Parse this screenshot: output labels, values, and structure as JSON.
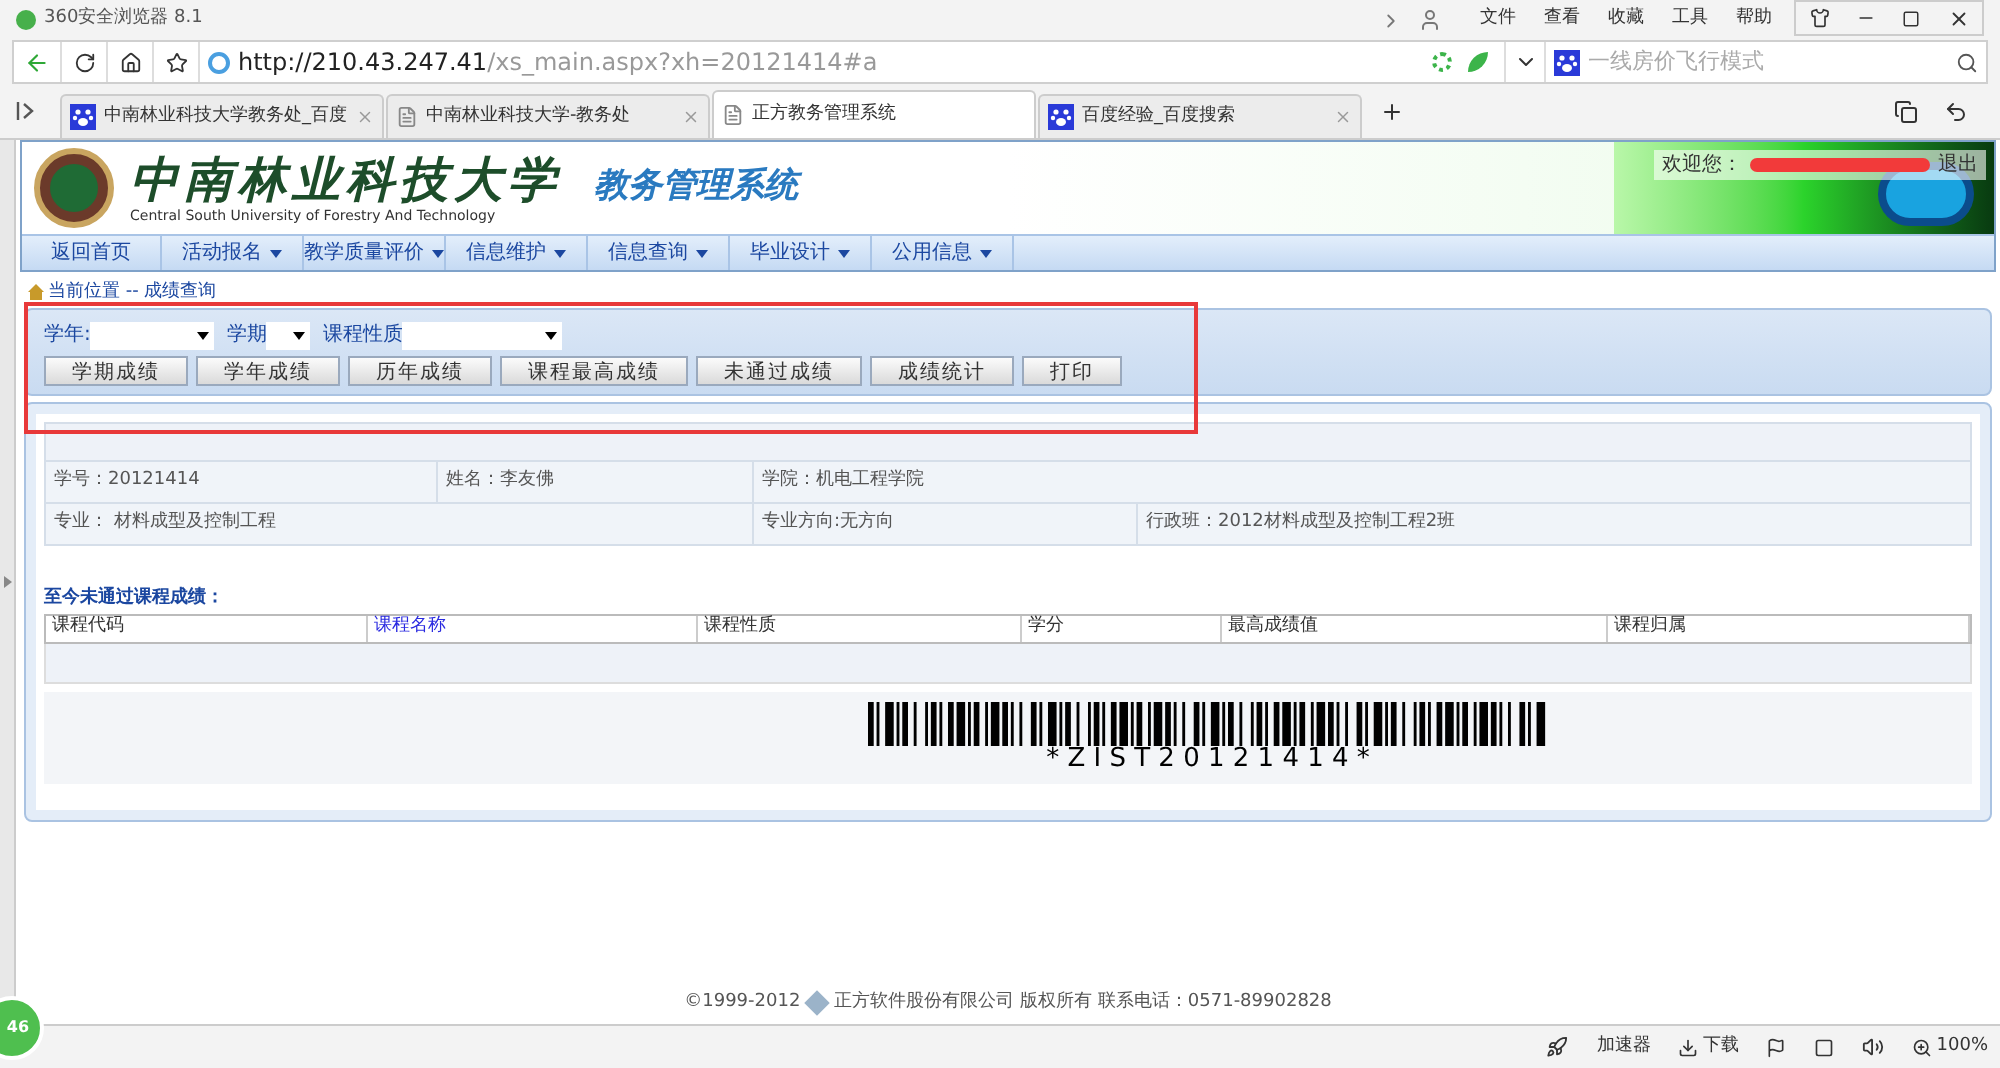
{
  "browser": {
    "title": "360安全浏览器 8.1",
    "menu": [
      "文件",
      "查看",
      "收藏",
      "工具",
      "帮助"
    ],
    "address": {
      "host": "http://210.43.247.41",
      "path": "/xs_main.aspx?xh=20121414#a"
    },
    "search": {
      "placeholder": "一线房价飞行模式"
    },
    "tabs": [
      {
        "label": "中南林业科技大学教务处_百度",
        "kind": "search",
        "selected": false
      },
      {
        "label": "中南林业科技大学-教务处",
        "kind": "page",
        "selected": false
      },
      {
        "label": "正方教务管理系统",
        "kind": "page",
        "selected": true
      },
      {
        "label": "百度经验_百度搜索",
        "kind": "search",
        "selected": false
      }
    ]
  },
  "header": {
    "school_cn": "中南林业科技大学",
    "school_en": "Central South University of Forestry And Technology",
    "system": "教务管理系统",
    "welcome": "欢迎您：",
    "logout": "退出"
  },
  "nav": [
    {
      "label": "返回首页",
      "has_menu": false
    },
    {
      "label": "活动报名",
      "has_menu": true
    },
    {
      "label": "教学质量评价",
      "has_menu": true
    },
    {
      "label": "信息维护",
      "has_menu": true
    },
    {
      "label": "信息查询",
      "has_menu": true
    },
    {
      "label": "毕业设计",
      "has_menu": true
    },
    {
      "label": "公用信息",
      "has_menu": true
    }
  ],
  "breadcrumb": "当前位置 -- 成绩查询",
  "filters": [
    {
      "label": "学年:"
    },
    {
      "label": "学期"
    },
    {
      "label": "课程性质"
    }
  ],
  "buttons": [
    "学期成绩",
    "学年成绩",
    "历年成绩",
    "课程最高成绩",
    "未通过成绩",
    "成绩统计",
    "打印"
  ],
  "student": {
    "fields": [
      "学号：20121414",
      "姓名：李友佛",
      "学院：机电工程学院",
      "专业： 材料成型及控制工程",
      "专业方向:无方向",
      "行政班：2012材料成型及控制工程2班"
    ]
  },
  "failed": {
    "title": "至今未通过课程成绩：",
    "columns": [
      {
        "label": "课程代码",
        "link": false
      },
      {
        "label": "课程名称",
        "link": true
      },
      {
        "label": "课程性质",
        "link": false
      },
      {
        "label": "学分",
        "link": false
      },
      {
        "label": "最高成绩值",
        "link": false
      },
      {
        "label": "课程归属",
        "link": false
      }
    ]
  },
  "barcode": "* Z I S T 2 0 1 2 1 4 1 4 *",
  "footer": {
    "copyright": "©1999-2012",
    "company": "正方软件股份有限公司 版权所有 联系电话：0571-89902828"
  },
  "status_bar": {
    "badge": "46",
    "accelerator": "加速器",
    "download": "下载",
    "zoom": "100%"
  }
}
